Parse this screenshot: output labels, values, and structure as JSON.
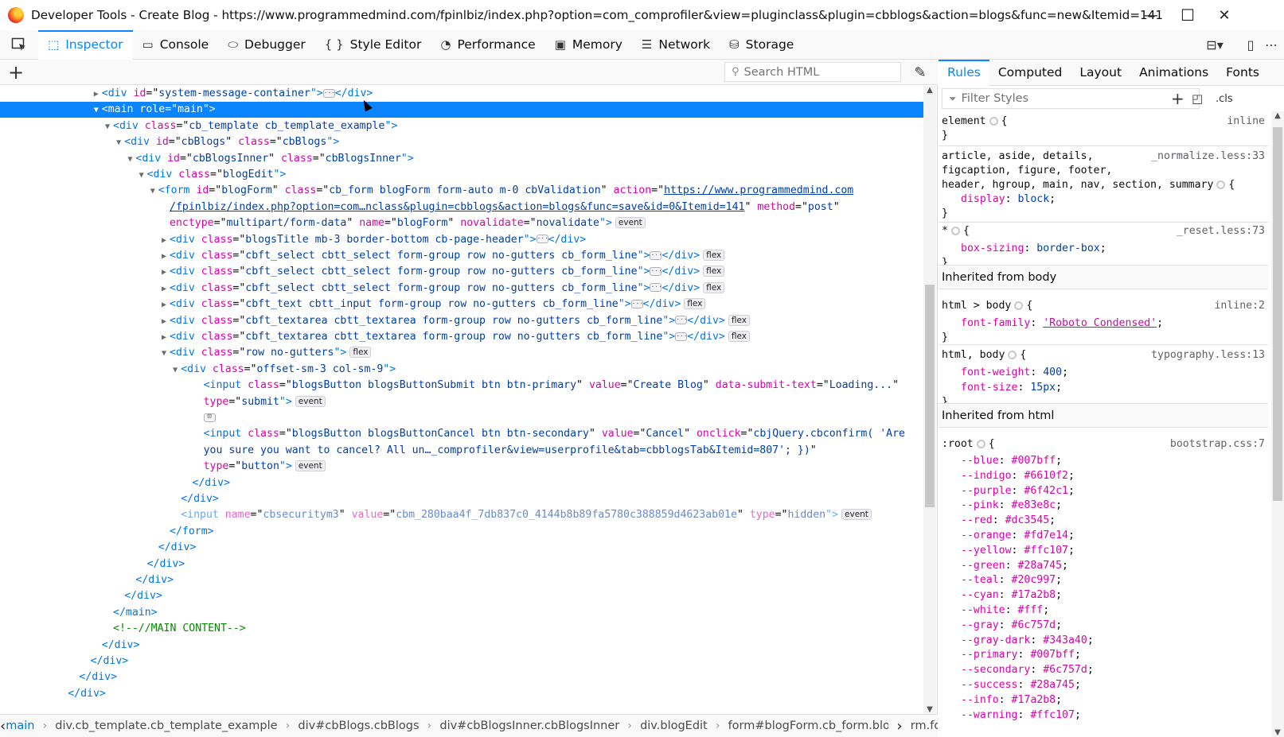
{
  "window": {
    "title": "Developer Tools - Create Blog - https://www.programmedmind.com/fpinlbiz/index.php?option=com_comprofiler&view=pluginclass&plugin=cbblogs&action=blogs&func=new&Itemid=141",
    "minimize": "—",
    "maximize": "☐",
    "close": "✕"
  },
  "toolbar": {
    "tools": [
      {
        "label": "Inspector",
        "icon": "inspector-icon",
        "glyph": "⬚"
      },
      {
        "label": "Console",
        "icon": "console-icon",
        "glyph": "▭"
      },
      {
        "label": "Debugger",
        "icon": "debugger-icon",
        "glyph": "⬭"
      },
      {
        "label": "Style Editor",
        "icon": "style-editor-icon",
        "glyph": "{ }"
      },
      {
        "label": "Performance",
        "icon": "performance-icon",
        "glyph": "◔"
      },
      {
        "label": "Memory",
        "icon": "memory-icon",
        "glyph": "▣"
      },
      {
        "label": "Network",
        "icon": "network-icon",
        "glyph": "☰"
      },
      {
        "label": "Storage",
        "icon": "storage-icon",
        "glyph": "⛁"
      }
    ],
    "active": "Inspector"
  },
  "markup": {
    "search_placeholder": "Search HTML",
    "add_glyph": "+",
    "eyedropper_glyph": "✎"
  },
  "tree": {
    "r0": [
      "<div ",
      "id",
      "=\"",
      "system-message-container",
      "\">",
      "</div>"
    ],
    "r1": "<main role=\"main\">",
    "r2": [
      "<div ",
      "class",
      "=\"",
      "cb_template cb_template_example",
      "\">"
    ],
    "r3": [
      "<div ",
      "id",
      "=\"",
      "cbBlogs",
      "\" ",
      "class",
      "=\"",
      "cbBlogs",
      "\">"
    ],
    "r4": [
      "<div ",
      "id",
      "=\"",
      "cbBlogsInner",
      "\" ",
      "class",
      "=\"",
      "cbBlogsInner",
      "\">"
    ],
    "r5": [
      "<div ",
      "class",
      "=\"",
      "blogEdit",
      "\">"
    ],
    "r6": [
      "<form ",
      "id",
      "=\"",
      "blogForm",
      "\" ",
      "class",
      "=\"",
      "cb_form blogForm form-auto m-0 cbValidation",
      "\" ",
      "action",
      "=\"",
      "https://www.programmedmind.com"
    ],
    "r7": [
      "/fpinlbiz/index.php?option=com…nclass&plugin=cbblogs&action=blogs&func=save&id=0&Itemid=141",
      "\" ",
      "method",
      "=\"",
      "post",
      "\""
    ],
    "r8": [
      "enctype",
      "=\"",
      "multipart/form-data",
      "\" ",
      "name",
      "=\"",
      "blogForm",
      "\" ",
      "novalidate",
      "=\"",
      "novalidate",
      "\">"
    ],
    "r9": [
      "<div ",
      "class",
      "=\"",
      "blogsTitle mb-3 border-bottom cb-page-header",
      "\">",
      "</div>"
    ],
    "r10": [
      "<div ",
      "class",
      "=\"",
      "cbft_select cbtt_select form-group row no-gutters cb_form_line",
      "\">",
      "</div>"
    ],
    "r11": [
      "<div ",
      "class",
      "=\"",
      "cbft_select cbtt_select form-group row no-gutters cb_form_line",
      "\">",
      "</div>"
    ],
    "r12": [
      "<div ",
      "class",
      "=\"",
      "cbft_select cbtt_select form-group row no-gutters cb_form_line",
      "\">",
      "</div>"
    ],
    "r13": [
      "<div ",
      "class",
      "=\"",
      "cbft_text cbtt_input form-group row no-gutters cb_form_line",
      "\">",
      "</div>"
    ],
    "r14": [
      "<div ",
      "class",
      "=\"",
      "cbft_textarea cbtt_textarea form-group row no-gutters cb_form_line",
      "\">",
      "</div>"
    ],
    "r15": [
      "<div ",
      "class",
      "=\"",
      "cbft_textarea cbtt_textarea form-group row no-gutters cb_form_line",
      "\">",
      "</div>"
    ],
    "r16": [
      "<div ",
      "class",
      "=\"",
      "row no-gutters",
      "\">"
    ],
    "r17": [
      "<div ",
      "class",
      "=\"",
      "offset-sm-3 col-sm-9",
      "\">"
    ],
    "r18": [
      "<input ",
      "class",
      "=\"",
      "blogsButton blogsButtonSubmit btn btn-primary",
      "\" ",
      "value",
      "=\"",
      "Create Blog",
      "\" ",
      "data-submit-text",
      "=\"",
      "Loading...",
      "\""
    ],
    "r19": [
      "type",
      "=\"",
      "submit",
      "\">"
    ],
    "r21": [
      "<input ",
      "class",
      "=\"",
      "blogsButton blogsButtonCancel btn btn-secondary",
      "\" ",
      "value",
      "=\"",
      "Cancel",
      "\" ",
      "onclick",
      "=\"",
      "cbjQuery.cbconfirm( 'Are"
    ],
    "r22": [
      "you sure you want to cancel? All un…_comprofiler&view=userprofile&tab=cbblogsTab&Itemid=807'; })",
      "\""
    ],
    "r23": [
      "type",
      "=\"",
      "button",
      "\">"
    ],
    "r24": "</div>",
    "r25": "</div>",
    "r26": [
      "<input ",
      "name",
      "=\"",
      "cbsecuritym3",
      "\" ",
      "value",
      "=\"",
      "cbm_280baa4f_7db837c0_4144b8b89fa5780c388859d4623ab01e",
      "\" ",
      "type",
      "=\"",
      "hidden",
      "\">"
    ],
    "r27": "</form>",
    "r28": "</div>",
    "r29": "</div>",
    "r30": "</div>",
    "r31": "</div>",
    "r32": "</main>",
    "r33": "<!--//MAIN CONTENT-->",
    "r34": "</div>",
    "r35": "</div>",
    "r36": "</div>",
    "r37": "</div>",
    "badges": {
      "event": "event",
      "flex": "flex",
      "ellipsis": "···",
      "whitespace": "⊡"
    }
  },
  "breadcrumbs": [
    "main",
    "div.cb_template.cb_template_example",
    "div#cbBlogs.cbBlogs",
    "div#cbBlogsInner.cbBlogsInner",
    "div.blogEdit",
    "form#blogForm.cb_form.blogForm.form-a"
  ],
  "sidebar": {
    "tabs": [
      "Rules",
      "Computed",
      "Layout",
      "Animations",
      "Fonts"
    ],
    "active_tab": "Rules",
    "filter_placeholder": "Filter Styles",
    "cls_label": ".cls",
    "rules": {
      "element_sel": "element",
      "element_src": "inline",
      "normalize_sel1": "article, aside, details,",
      "normalize_sel2": "figcaption, figure, footer,",
      "normalize_sel3": "header, hgroup, main, nav, section, summary",
      "normalize_src": "_normalize.less:33",
      "display_prop": "display",
      "display_val": "block",
      "reset_sel": "*",
      "reset_src": "_reset.less:73",
      "boxsizing_prop": "box-sizing",
      "boxsizing_val": "border-box",
      "inherited_body": "Inherited from body",
      "body1_sel": "html > body",
      "body1_src": "inline:2",
      "fontfamily_prop": "font-family",
      "fontfamily_val": "'Roboto Condensed'",
      "body2_sel": "html, body",
      "body2_src": "typography.less:13",
      "fontweight_prop": "font-weight",
      "fontweight_val": "400",
      "fontsize_prop": "font-size",
      "fontsize_val": "15px",
      "inherited_html": "Inherited from html",
      "root_sel": ":root",
      "root_src": "bootstrap.css:7",
      "vars": [
        [
          "--blue",
          "#007bff"
        ],
        [
          "--indigo",
          "#6610f2"
        ],
        [
          "--purple",
          "#6f42c1"
        ],
        [
          "--pink",
          "#e83e8c"
        ],
        [
          "--red",
          "#dc3545"
        ],
        [
          "--orange",
          "#fd7e14"
        ],
        [
          "--yellow",
          "#ffc107"
        ],
        [
          "--green",
          "#28a745"
        ],
        [
          "--teal",
          "#20c997"
        ],
        [
          "--cyan",
          "#17a2b8"
        ],
        [
          "--white",
          "#fff"
        ],
        [
          "--gray",
          "#6c757d"
        ],
        [
          "--gray-dark",
          "#343a40"
        ],
        [
          "--primary",
          "#007bff"
        ],
        [
          "--secondary",
          "#6c757d"
        ],
        [
          "--success",
          "#28a745"
        ],
        [
          "--info",
          "#17a2b8"
        ],
        [
          "--warning",
          "#ffc107"
        ]
      ]
    }
  },
  "colors": {
    "accent": "#0a84ff",
    "tag": "#0074e8",
    "attr_name": "#dd00a9",
    "attr_value": "#003eaa",
    "comment": "#058b00"
  }
}
